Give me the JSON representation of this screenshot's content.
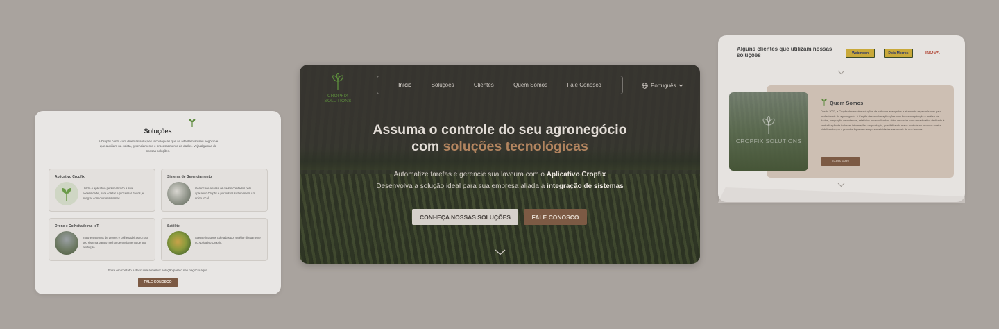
{
  "left_card": {
    "title": "Soluções",
    "description": "A Cropfix conta com diversas soluções tecnológicas que se adaptam ao seu negócio e que auxiliam na coleta, gerenciamento e processamento de dados. Veja algumas de nossas soluções.",
    "solutions": [
      {
        "name": "Aplicativo Cropfix",
        "text": "Utilize o aplicativo personalizado à sua necessidade, para coletar e processar dados, e integrar com outros sistemas."
      },
      {
        "name": "Sistema de Gerenciamento",
        "text": "Gerencie e analise os dados coletados pelo aplicativo Cropfix e por outros sistemas em um único local."
      },
      {
        "name": "Drone e Colheitadeiras IoT",
        "text": "Integre sistemas de drones e colheitadeiras IoT ao seu sistema para o melhor gerenciamento de sua produção."
      },
      {
        "name": "Satélite",
        "text": "Acesse imagens coletadas por satélite diretamente no Aplicativo Cropfix."
      }
    ],
    "cta_text": "Entre em contato e descubra a melhor solução para o seu negócio agro.",
    "cta_button": "FALE CONOSCO"
  },
  "center_card": {
    "logo_text": "CROPFIX SOLUTIONS",
    "nav": [
      "Início",
      "Soluções",
      "Clientes",
      "Quem Somos",
      "Fale Conosco"
    ],
    "language": "Português",
    "hero_title_1": "Assuma o controle do seu agronegócio",
    "hero_title_2_plain": "com ",
    "hero_title_2_accent": "soluções tecnológicas",
    "hero_sub_1_plain": "Automatize tarefas e gerencie sua lavoura com o ",
    "hero_sub_1_bold": "Aplicativo Cropfix",
    "hero_sub_2_plain": "Desenvolva a solução ideal para sua empresa aliada à ",
    "hero_sub_2_bold": "integração de sistemas",
    "btn_primary": "CONHEÇA NOSSAS SOLUÇÕES",
    "btn_secondary": "FALE CONOSCO"
  },
  "right_card": {
    "clients_title": "Alguns clientes que utilizam nossas soluções",
    "client_logos": [
      "Webmoon",
      "Dois Morros",
      "INOVA"
    ],
    "image_logo_text": "CROPFIX SOLUTIONS",
    "about_title": "Quem Somos",
    "about_text": "Desde 2022, a Cropfix desenvolve soluções de software avançadas e altamente especializadas para profissionais do agronegócio. A Cropfix desenvolve aplicações com foco em aquisição e análise de dados, integração de sistemas, relatórios personalizados, além de contar com um aplicativo dedicado à centralização de todas as informações da produção, possibilitando maior controle ao produtor rural e viabilizando que o produtor fique seu tempo em atividades essenciais de sua lavoura.",
    "about_button": "SAIBA MAIS"
  },
  "colors": {
    "background": "#a9a39e",
    "accent_brown": "#7c5a44",
    "accent_copper": "#b2845f",
    "brand_green": "#5c8a3c"
  }
}
